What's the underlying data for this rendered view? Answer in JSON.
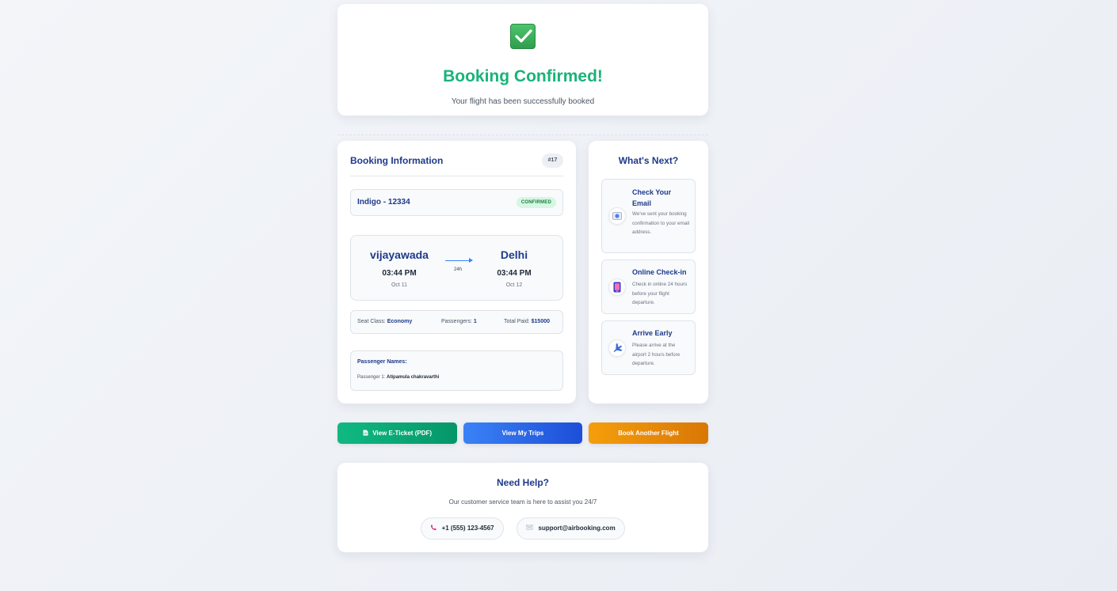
{
  "confirmation": {
    "title": "Booking Confirmed!",
    "subtitle": "Your flight has been successfully booked",
    "icon": "check-mark-icon"
  },
  "booking": {
    "title": "Booking Information",
    "booking_id": "#17",
    "flight_name": "Indigo - 12334",
    "status": "CONFIRMED",
    "origin": {
      "city": "vijayawada",
      "time": "03:44 PM",
      "date": "Oct 11"
    },
    "destination": {
      "city": "Delhi",
      "time": "03:44 PM",
      "date": "Oct 12"
    },
    "duration": "24h",
    "seat_class_label": "Seat Class:",
    "seat_class": "Economy",
    "passengers_label": "Passengers:",
    "passengers": "1",
    "total_label": "Total Paid:",
    "total": "$15000",
    "passenger_names_title": "Passenger Names:",
    "passenger_list": [
      {
        "label": "Passenger 1:",
        "name": "Atipamula chakravarthi"
      }
    ]
  },
  "next_steps": {
    "title": "What's Next?",
    "steps": [
      {
        "icon": "email-icon",
        "title": "Check Your Email",
        "description": "We've sent your booking confirmation to your email address."
      },
      {
        "icon": "mobile-phone-icon",
        "title": "Online Check-in",
        "description": "Check in online 24 hours before your flight departure."
      },
      {
        "icon": "airplane-icon",
        "title": "Arrive Early",
        "description": "Please arrive at the airport 2 hours before departure."
      }
    ]
  },
  "actions": {
    "ticket_label": "View E-Ticket (PDF)",
    "trips_label": "View My Trips",
    "book_label": "Book Another Flight"
  },
  "help": {
    "title": "Need Help?",
    "subtitle": "Our customer service team is here to assist you 24/7",
    "phone": "+1 (555) 123-4567",
    "email": "support@airbooking.com"
  },
  "colors": {
    "success": "#19b37a",
    "primary_text": "#1e3a8a",
    "green_button": "#10b981",
    "blue_button": "#3b82f6",
    "orange_button": "#f59e0b"
  }
}
